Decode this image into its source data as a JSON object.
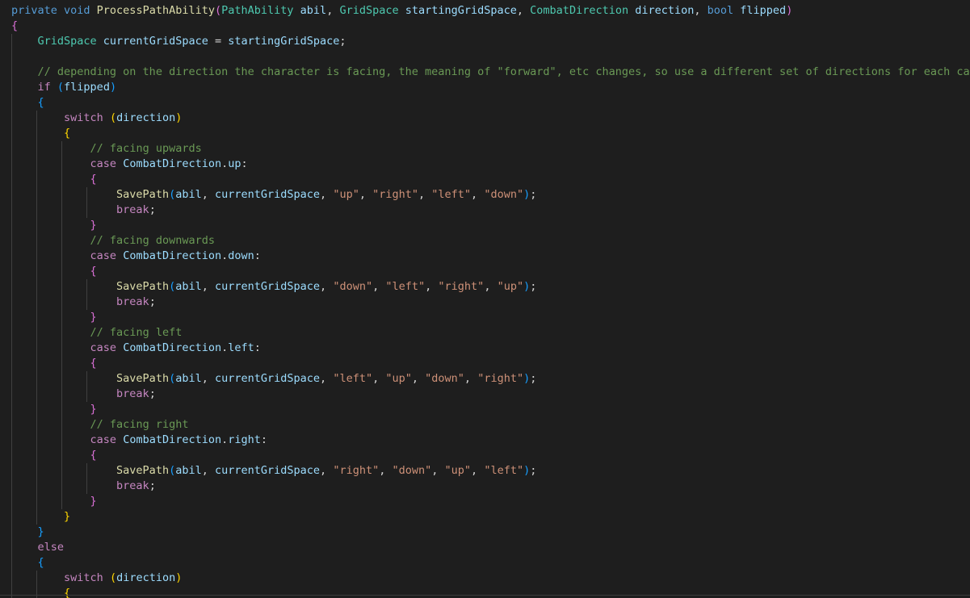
{
  "editor": {
    "language": "csharp",
    "theme_colors": {
      "background": "#1e1e1e",
      "keyword": "#569cd6",
      "control": "#c586c0",
      "type": "#4ec9b0",
      "function": "#dcdcaa",
      "variable": "#9cdcfe",
      "string": "#ce9178",
      "comment": "#6a9955",
      "bracket_1": "#ffd700",
      "bracket_2": "#da70d6",
      "bracket_3": "#179fff"
    },
    "lines": [
      {
        "indent": 0,
        "tokens": [
          [
            "private void ",
            "kw"
          ],
          [
            "ProcessPathAbility",
            "fn"
          ],
          [
            "(",
            "b2"
          ],
          [
            "PathAbility ",
            "typ"
          ],
          [
            "abil",
            "var"
          ],
          [
            ", ",
            "pun"
          ],
          [
            "GridSpace ",
            "typ"
          ],
          [
            "startingGridSpace",
            "var"
          ],
          [
            ", ",
            "pun"
          ],
          [
            "CombatDirection ",
            "typ"
          ],
          [
            "direction",
            "var"
          ],
          [
            ", ",
            "pun"
          ],
          [
            "bool ",
            "kw"
          ],
          [
            "flipped",
            "var"
          ],
          [
            ")",
            "b2"
          ]
        ]
      },
      {
        "indent": 0,
        "tokens": [
          [
            "{",
            "b2"
          ]
        ]
      },
      {
        "indent": 1,
        "tokens": [
          [
            "GridSpace ",
            "typ"
          ],
          [
            "currentGridSpace",
            "var"
          ],
          [
            " = ",
            "pun"
          ],
          [
            "startingGridSpace",
            "var"
          ],
          [
            ";",
            "pun"
          ]
        ]
      },
      {
        "indent": 0,
        "tokens": []
      },
      {
        "indent": 1,
        "tokens": [
          [
            "// depending on the direction the character is facing, the meaning of \"forward\", etc changes, so use a different set of directions for each case",
            "cmt"
          ]
        ]
      },
      {
        "indent": 1,
        "tokens": [
          [
            "if ",
            "ctl"
          ],
          [
            "(",
            "b3"
          ],
          [
            "flipped",
            "var"
          ],
          [
            ")",
            "b3"
          ]
        ]
      },
      {
        "indent": 1,
        "tokens": [
          [
            "{",
            "b3"
          ]
        ]
      },
      {
        "indent": 2,
        "tokens": [
          [
            "switch ",
            "ctl"
          ],
          [
            "(",
            "b1"
          ],
          [
            "direction",
            "var"
          ],
          [
            ")",
            "b1"
          ]
        ]
      },
      {
        "indent": 2,
        "tokens": [
          [
            "{",
            "b1"
          ]
        ]
      },
      {
        "indent": 3,
        "tokens": [
          [
            "// facing upwards",
            "cmt"
          ]
        ]
      },
      {
        "indent": 3,
        "tokens": [
          [
            "case ",
            "ctl"
          ],
          [
            "CombatDirection",
            "var"
          ],
          [
            ".",
            "pun"
          ],
          [
            "up",
            "var"
          ],
          [
            ":",
            "pun"
          ]
        ]
      },
      {
        "indent": 3,
        "tokens": [
          [
            "{",
            "b2"
          ]
        ]
      },
      {
        "indent": 4,
        "tokens": [
          [
            "SavePath",
            "fn"
          ],
          [
            "(",
            "b3"
          ],
          [
            "abil",
            "var"
          ],
          [
            ", ",
            "pun"
          ],
          [
            "currentGridSpace",
            "var"
          ],
          [
            ", ",
            "pun"
          ],
          [
            "\"up\"",
            "str"
          ],
          [
            ", ",
            "pun"
          ],
          [
            "\"right\"",
            "str"
          ],
          [
            ", ",
            "pun"
          ],
          [
            "\"left\"",
            "str"
          ],
          [
            ", ",
            "pun"
          ],
          [
            "\"down\"",
            "str"
          ],
          [
            ")",
            "b3"
          ],
          [
            ";",
            "pun"
          ]
        ]
      },
      {
        "indent": 4,
        "tokens": [
          [
            "break",
            "ctl"
          ],
          [
            ";",
            "pun"
          ]
        ]
      },
      {
        "indent": 3,
        "tokens": [
          [
            "}",
            "b2"
          ]
        ]
      },
      {
        "indent": 3,
        "tokens": [
          [
            "// facing downwards",
            "cmt"
          ]
        ]
      },
      {
        "indent": 3,
        "tokens": [
          [
            "case ",
            "ctl"
          ],
          [
            "CombatDirection",
            "var"
          ],
          [
            ".",
            "pun"
          ],
          [
            "down",
            "var"
          ],
          [
            ":",
            "pun"
          ]
        ]
      },
      {
        "indent": 3,
        "tokens": [
          [
            "{",
            "b2"
          ]
        ]
      },
      {
        "indent": 4,
        "tokens": [
          [
            "SavePath",
            "fn"
          ],
          [
            "(",
            "b3"
          ],
          [
            "abil",
            "var"
          ],
          [
            ", ",
            "pun"
          ],
          [
            "currentGridSpace",
            "var"
          ],
          [
            ", ",
            "pun"
          ],
          [
            "\"down\"",
            "str"
          ],
          [
            ", ",
            "pun"
          ],
          [
            "\"left\"",
            "str"
          ],
          [
            ", ",
            "pun"
          ],
          [
            "\"right\"",
            "str"
          ],
          [
            ", ",
            "pun"
          ],
          [
            "\"up\"",
            "str"
          ],
          [
            ")",
            "b3"
          ],
          [
            ";",
            "pun"
          ]
        ]
      },
      {
        "indent": 4,
        "tokens": [
          [
            "break",
            "ctl"
          ],
          [
            ";",
            "pun"
          ]
        ]
      },
      {
        "indent": 3,
        "tokens": [
          [
            "}",
            "b2"
          ]
        ]
      },
      {
        "indent": 3,
        "tokens": [
          [
            "// facing left",
            "cmt"
          ]
        ]
      },
      {
        "indent": 3,
        "tokens": [
          [
            "case ",
            "ctl"
          ],
          [
            "CombatDirection",
            "var"
          ],
          [
            ".",
            "pun"
          ],
          [
            "left",
            "var"
          ],
          [
            ":",
            "pun"
          ]
        ]
      },
      {
        "indent": 3,
        "tokens": [
          [
            "{",
            "b2"
          ]
        ]
      },
      {
        "indent": 4,
        "tokens": [
          [
            "SavePath",
            "fn"
          ],
          [
            "(",
            "b3"
          ],
          [
            "abil",
            "var"
          ],
          [
            ", ",
            "pun"
          ],
          [
            "currentGridSpace",
            "var"
          ],
          [
            ", ",
            "pun"
          ],
          [
            "\"left\"",
            "str"
          ],
          [
            ", ",
            "pun"
          ],
          [
            "\"up\"",
            "str"
          ],
          [
            ", ",
            "pun"
          ],
          [
            "\"down\"",
            "str"
          ],
          [
            ", ",
            "pun"
          ],
          [
            "\"right\"",
            "str"
          ],
          [
            ")",
            "b3"
          ],
          [
            ";",
            "pun"
          ]
        ]
      },
      {
        "indent": 4,
        "tokens": [
          [
            "break",
            "ctl"
          ],
          [
            ";",
            "pun"
          ]
        ]
      },
      {
        "indent": 3,
        "tokens": [
          [
            "}",
            "b2"
          ]
        ]
      },
      {
        "indent": 3,
        "tokens": [
          [
            "// facing right",
            "cmt"
          ]
        ]
      },
      {
        "indent": 3,
        "tokens": [
          [
            "case ",
            "ctl"
          ],
          [
            "CombatDirection",
            "var"
          ],
          [
            ".",
            "pun"
          ],
          [
            "right",
            "var"
          ],
          [
            ":",
            "pun"
          ]
        ]
      },
      {
        "indent": 3,
        "tokens": [
          [
            "{",
            "b2"
          ]
        ]
      },
      {
        "indent": 4,
        "tokens": [
          [
            "SavePath",
            "fn"
          ],
          [
            "(",
            "b3"
          ],
          [
            "abil",
            "var"
          ],
          [
            ", ",
            "pun"
          ],
          [
            "currentGridSpace",
            "var"
          ],
          [
            ", ",
            "pun"
          ],
          [
            "\"right\"",
            "str"
          ],
          [
            ", ",
            "pun"
          ],
          [
            "\"down\"",
            "str"
          ],
          [
            ", ",
            "pun"
          ],
          [
            "\"up\"",
            "str"
          ],
          [
            ", ",
            "pun"
          ],
          [
            "\"left\"",
            "str"
          ],
          [
            ")",
            "b3"
          ],
          [
            ";",
            "pun"
          ]
        ]
      },
      {
        "indent": 4,
        "tokens": [
          [
            "break",
            "ctl"
          ],
          [
            ";",
            "pun"
          ]
        ]
      },
      {
        "indent": 3,
        "tokens": [
          [
            "}",
            "b2"
          ]
        ]
      },
      {
        "indent": 2,
        "tokens": [
          [
            "}",
            "b1"
          ]
        ]
      },
      {
        "indent": 1,
        "tokens": [
          [
            "}",
            "b3"
          ]
        ]
      },
      {
        "indent": 1,
        "tokens": [
          [
            "else",
            "ctl"
          ]
        ]
      },
      {
        "indent": 1,
        "tokens": [
          [
            "{",
            "b3"
          ]
        ]
      },
      {
        "indent": 2,
        "tokens": [
          [
            "switch ",
            "ctl"
          ],
          [
            "(",
            "b1"
          ],
          [
            "direction",
            "var"
          ],
          [
            ")",
            "b1"
          ]
        ]
      },
      {
        "indent": 2,
        "tokens": [
          [
            "{",
            "b1"
          ]
        ]
      }
    ]
  }
}
